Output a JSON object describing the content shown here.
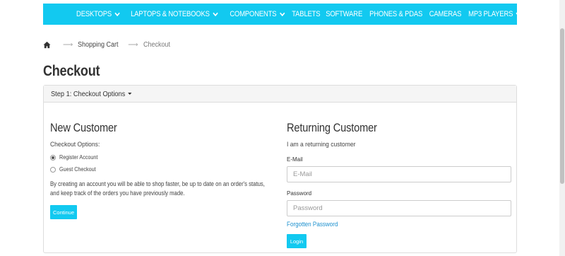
{
  "nav": {
    "items": [
      {
        "label": "Desktops",
        "has_dropdown": true
      },
      {
        "label": "Laptops & Notebooks",
        "has_dropdown": true
      },
      {
        "label": "Components",
        "has_dropdown": true
      },
      {
        "label": "Tablets",
        "has_dropdown": false
      },
      {
        "label": "Software",
        "has_dropdown": false
      },
      {
        "label": "Phones & PDAs",
        "has_dropdown": false
      },
      {
        "label": "Cameras",
        "has_dropdown": false
      },
      {
        "label": "MP3 Players",
        "has_dropdown": true
      }
    ],
    "background_color": "#12c9f0"
  },
  "breadcrumb": {
    "home_icon": "home-icon",
    "items": [
      "Shopping Cart",
      "Checkout"
    ]
  },
  "page": {
    "title": "Checkout"
  },
  "step": {
    "label": "Step 1: Checkout Options"
  },
  "new_customer": {
    "title": "New Customer",
    "options_label": "Checkout Options:",
    "options": [
      {
        "label": "Register Account",
        "checked": true
      },
      {
        "label": "Guest Checkout",
        "checked": false
      }
    ],
    "help_text": "By creating an account you will be able to shop faster, be up to date on an order's status, and keep track of the orders you have previously made.",
    "continue_label": "Continue"
  },
  "returning_customer": {
    "title": "Returning Customer",
    "intro": "I am a returning customer",
    "email_label": "E-Mail",
    "email_placeholder": "E-Mail",
    "password_label": "Password",
    "password_placeholder": "Password",
    "forgot_label": "Forgotten Password",
    "login_label": "Login"
  },
  "colors": {
    "accent": "#12c9f0",
    "link": "#1e91cf"
  }
}
